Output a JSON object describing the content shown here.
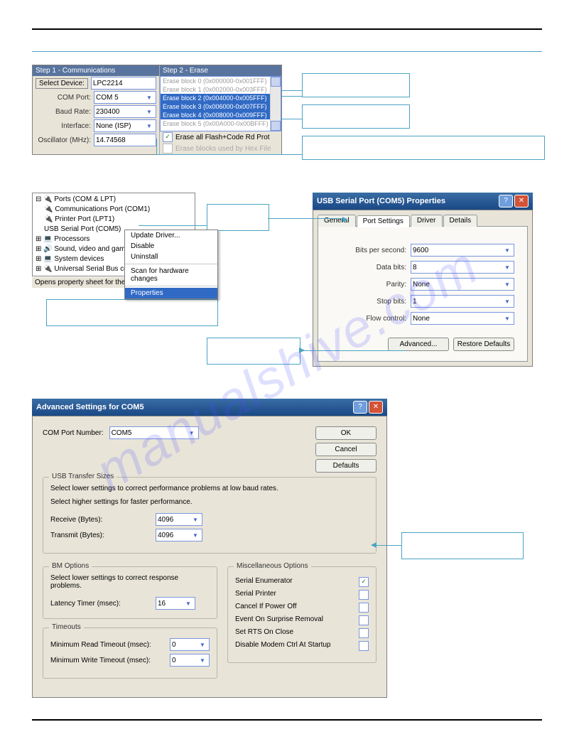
{
  "step1": {
    "title": "Step 1 - Communications",
    "select_device_btn": "Select Device:",
    "device_value": "LPC2214",
    "com_port_label": "COM Port:",
    "com_port_value": "COM 5",
    "baud_label": "Baud Rate:",
    "baud_value": "230400",
    "interface_label": "Interface:",
    "interface_value": "None (ISP)",
    "osc_label": "Oscillator (MHz):",
    "osc_value": "14.74568"
  },
  "step2": {
    "title": "Step 2 - Erase",
    "items": [
      "Erase block 0 (0x000000-0x001FFF)",
      "Erase block 1 (0x002000-0x003FFF)",
      "Erase block 2 (0x004000-0x005FFF)",
      "Erase block 3 (0x006000-0x007FFF)",
      "Erase block 4 (0x008000-0x009FFF)",
      "Erase block 5 (0x00A000-0x00BFFF)"
    ],
    "erase_all_label": "Erase all Flash+Code Rd Prot",
    "erase_used_label": "Erase blocks used by Hex File"
  },
  "tree": {
    "root": "Ports (COM & LPT)",
    "items": [
      "Communications Port (COM1)",
      "Printer Port (LPT1)",
      "USB Serial Port (COM5)"
    ],
    "siblings": [
      "Processors",
      "Sound, video and game controllers",
      "System devices",
      "Universal Serial Bus controllers"
    ],
    "status": "Opens property sheet for the current selection."
  },
  "menu": {
    "items": [
      "Update Driver...",
      "Disable",
      "Uninstall",
      "Scan for hardware changes",
      "Properties"
    ]
  },
  "props": {
    "title": "USB Serial Port (COM5) Properties",
    "tabs": [
      "General",
      "Port Settings",
      "Driver",
      "Details"
    ],
    "bits_per_second_label": "Bits per second:",
    "bits_per_second_value": "9600",
    "data_bits_label": "Data bits:",
    "data_bits_value": "8",
    "parity_label": "Parity:",
    "parity_value": "None",
    "stop_bits_label": "Stop bits:",
    "stop_bits_value": "1",
    "flow_label": "Flow control:",
    "flow_value": "None",
    "advanced_btn": "Advanced...",
    "restore_btn": "Restore Defaults"
  },
  "adv": {
    "title": "Advanced Settings for COM5",
    "com_port_label": "COM Port Number:",
    "com_port_value": "COM5",
    "ok": "OK",
    "cancel": "Cancel",
    "defaults": "Defaults",
    "usb_group": "USB Transfer Sizes",
    "usb_note1": "Select lower settings to correct performance problems at low baud rates.",
    "usb_note2": "Select higher settings for faster performance.",
    "recv_label": "Receive (Bytes):",
    "recv_value": "4096",
    "xmit_label": "Transmit (Bytes):",
    "xmit_value": "4096",
    "bm_group": "BM Options",
    "bm_note": "Select lower settings to correct response problems.",
    "latency_label": "Latency Timer (msec):",
    "latency_value": "16",
    "timeouts_group": "Timeouts",
    "min_read_label": "Minimum Read Timeout (msec):",
    "min_read_value": "0",
    "min_write_label": "Minimum Write Timeout (msec):",
    "min_write_value": "0",
    "misc_group": "Miscellaneous Options",
    "misc_items": [
      "Serial Enumerator",
      "Serial Printer",
      "Cancel If Power Off",
      "Event On Surprise Removal",
      "Set RTS On Close",
      "Disable Modem Ctrl At Startup"
    ]
  },
  "watermark": "manualshive.com"
}
